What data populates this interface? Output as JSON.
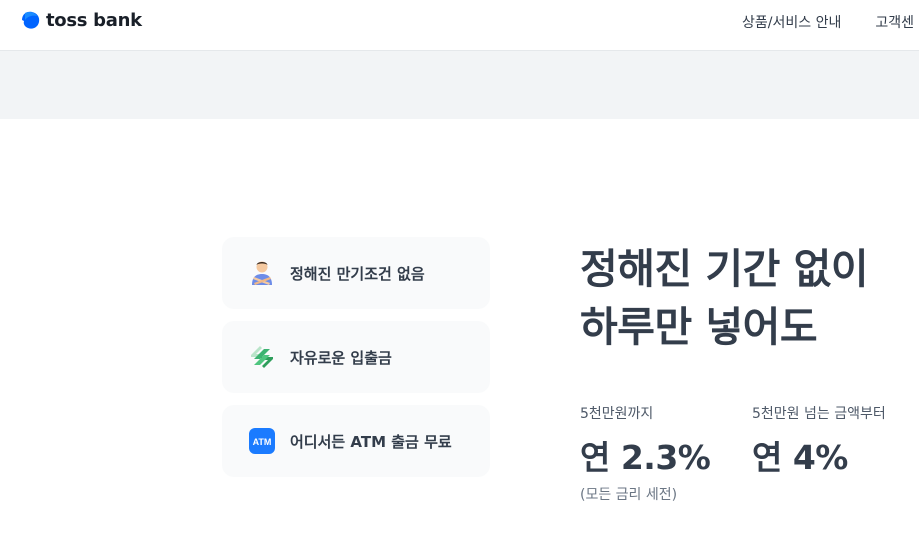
{
  "header": {
    "logo_text": "toss bank",
    "nav": [
      "상품/서비스 안내",
      "고객센"
    ]
  },
  "features": [
    {
      "icon": "crossed-arms-person-icon",
      "label": "정해진 만기조건 없음"
    },
    {
      "icon": "transfer-arrows-icon",
      "label": "자유로운 입출금"
    },
    {
      "icon": "atm-icon",
      "label": "어디서든 ATM 출금 무료",
      "icon_text": "ATM"
    }
  ],
  "headline": {
    "line1": "정해진 기간 없이",
    "line2": "하루만 넣어도"
  },
  "rates": [
    {
      "label": "5천만원까지",
      "value": "연 2.3%"
    },
    {
      "label": "5천만원 넘는 금액부터",
      "value": "연 4%"
    }
  ],
  "footnote": "(모든 금리 세전)",
  "colors": {
    "brand_blue": "#0064ff",
    "text_primary": "#333d4b",
    "card_bg": "#f9fafb",
    "banner_bg": "#f2f4f6",
    "green_icon": "#3cb371"
  }
}
